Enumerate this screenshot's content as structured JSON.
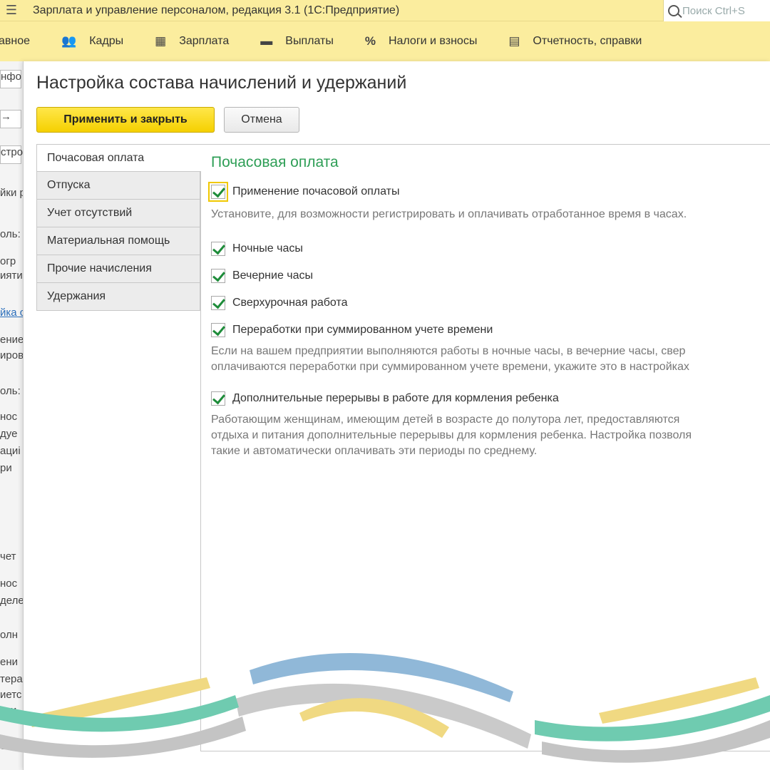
{
  "titlebar": {
    "title": "Зарплата и управление персоналом, редакция 3.1  (1С:Предприятие)",
    "search_placeholder": "Поиск Ctrl+S"
  },
  "sections": [
    {
      "label": "Главное",
      "visible_label": "авное",
      "icon": "home-icon"
    },
    {
      "label": "Кадры",
      "icon": "people-icon"
    },
    {
      "label": "Зарплата",
      "icon": "calculator-icon"
    },
    {
      "label": "Выплаты",
      "icon": "wallet-icon"
    },
    {
      "label": "Налоги и взносы",
      "icon": "percent-icon"
    },
    {
      "label": "Отчетность, справки",
      "icon": "report-icon"
    }
  ],
  "background_fragments": [
    "нфо",
    "→",
    "стро",
    "йки р",
    "оль:",
    "огр",
    "ияти",
    "йка с",
    "ение",
    "иров",
    "оль:",
    "нос",
    "дуе",
    "ациі",
    "ри",
    "чет",
    "нос",
    "деле",
    "олн",
    "ени",
    "тера",
    "иетс",
    "ати",
    "олн"
  ],
  "dialog": {
    "title": "Настройка состава начислений и удержаний",
    "apply_label": "Применить и закрыть",
    "cancel_label": "Отмена"
  },
  "tabs": [
    {
      "label": "Почасовая оплата",
      "active": true
    },
    {
      "label": "Отпуска"
    },
    {
      "label": "Учет отсутствий"
    },
    {
      "label": "Материальная помощь"
    },
    {
      "label": "Прочие начисления"
    },
    {
      "label": "Удержания"
    }
  ],
  "pane": {
    "title": "Почасовая оплата",
    "hourly": {
      "label": "Применение почасовой оплаты",
      "checked": true
    },
    "hourly_hint": "Установите, для возможности регистрировать и оплачивать отработанное время в часах.",
    "options": [
      {
        "label": "Ночные часы",
        "checked": true
      },
      {
        "label": "Вечерние часы",
        "checked": true
      },
      {
        "label": "Сверхурочная работа",
        "checked": true
      },
      {
        "label": "Переработки при суммированном учете времени",
        "checked": true
      }
    ],
    "options_hint_1": "Если на вашем предприятии выполняются работы в ночные часы, в вечерние часы, свер",
    "options_hint_2": "оплачиваются переработки при суммированном учете времени, укажите это в настройках",
    "feeding": {
      "label": "Дополнительные перерывы в работе для кормления ребенка",
      "checked": true
    },
    "feeding_hint_1": "Работающим женщинам, имеющим детей в возрасте до полутора лет, предоставляются",
    "feeding_hint_2": "отдыха и питания дополнительные перерывы для кормления ребенка. Настройка позволя",
    "feeding_hint_3": "такие и автоматически оплачивать эти периоды по среднему."
  },
  "colors": {
    "bar": "#fbed9e",
    "primary_button": "#f5d000",
    "pane_title": "#2e9e56",
    "check": "#1e8c3a",
    "deco_blue": "#8ab4d6",
    "deco_yellow": "#f0d982",
    "deco_green": "#6fcbb0",
    "deco_gray": "#c4c4c4"
  }
}
